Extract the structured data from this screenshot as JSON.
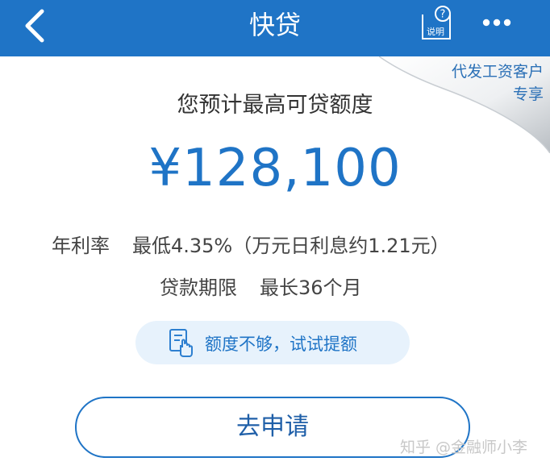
{
  "header": {
    "title": "快贷",
    "help_label": "说明"
  },
  "corner_badge": {
    "line1": "代发工资客户",
    "line2": "专享"
  },
  "main": {
    "subtitle": "您预计最高可贷额度",
    "amount": "¥128,100",
    "rate_label": "年利率",
    "rate_value": "最低4.35%（万元日利息约1.21元）",
    "term_label": "贷款期限",
    "term_value": "最长36个月",
    "tip_text": "额度不够，试试提额",
    "apply_label": "去申请"
  },
  "watermark": "知乎 @金融师小李",
  "colors": {
    "header": "#1f74c6",
    "accent": "#1f74c6",
    "tip_background": "#e7f2fc"
  },
  "icons": [
    "back-arrow-icon",
    "help-document-icon",
    "more-dots-icon",
    "tap-document-icon"
  ]
}
